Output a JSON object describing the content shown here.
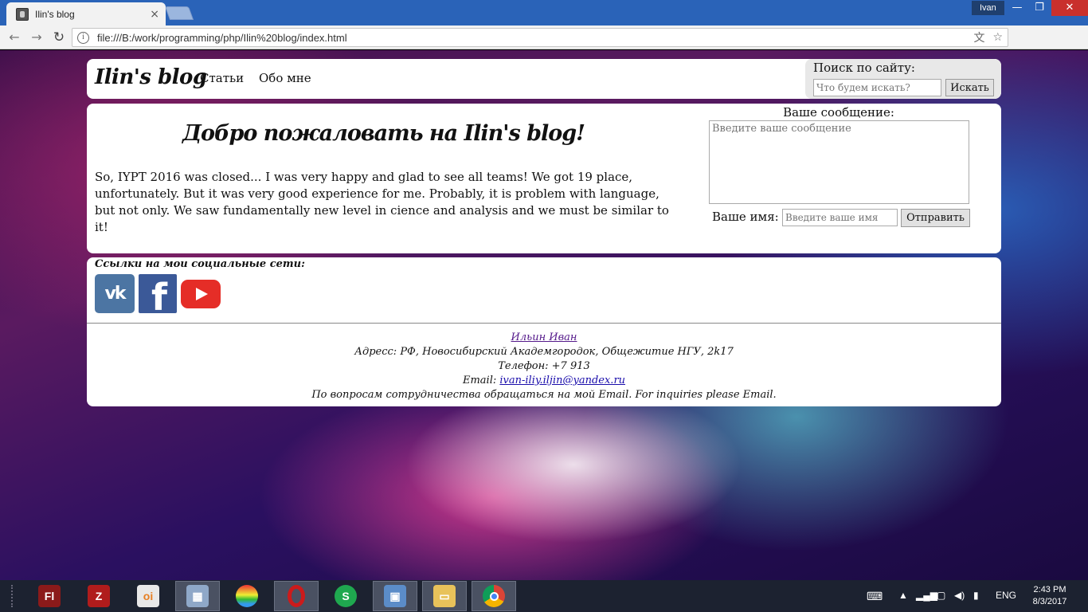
{
  "browser": {
    "tab_title": "Ilin's blog",
    "tab_close": "×",
    "profile_name": "Ivan",
    "url": "file:///B:/work/programming/php/Ilin%20blog/index.html",
    "minimize": "—",
    "maximize": "❐",
    "close": "✕",
    "back": "←",
    "forward": "→",
    "reload": "↻",
    "info": "i",
    "translate_icon": "文",
    "star_icon": "☆"
  },
  "header": {
    "logo": "Ilin's blog",
    "nav": [
      {
        "label": "Статьи"
      },
      {
        "label": "Обо мне"
      }
    ],
    "search": {
      "title": "Поиск по сайту:",
      "placeholder": "Что будем искать?",
      "button": "Искать"
    }
  },
  "main": {
    "welcome": "Добро пожаловать на Ilin's blog!",
    "post": "So, IYPT 2016 was closed... I was very happy and glad to see all teams! We got 19 place, unfortunately. But it was very good experience for me. Probably, it is problem with language, but not only. We saw fundamentally new level in cience and analysis and we must be similar to it!",
    "form": {
      "message_label": "Ваше сообщение:",
      "message_placeholder": "Введите ваше сообщение",
      "name_label": "Ваше имя:",
      "name_placeholder": "Введите ваше имя",
      "send_button": "Отправить"
    }
  },
  "footer": {
    "social_title": "Ссылки на мои социальные сети:",
    "social": {
      "vk": "vk",
      "fb": "f"
    },
    "author": "Ильин Иван",
    "address": "Адресс: РФ, Новосибирский Академгородок, Общежитие НГУ, 2k17",
    "phone": "Телефон: +7 913",
    "email_prefix": "Email: ",
    "email": "ivan-iliy.iljin@yandex.ru",
    "note": "По вопросам сотрудничества обращаться на мой Email. For inquiries please Email."
  },
  "taskbar": {
    "apps": [
      {
        "name": "flash",
        "glyph": "Fl",
        "color": "#8b1a1a"
      },
      {
        "name": "filezilla",
        "glyph": "Z",
        "color": "#b01c1c"
      },
      {
        "name": "origin",
        "glyph": "oi",
        "color": "#e8e8e8"
      },
      {
        "name": "monitor",
        "glyph": "▦",
        "color": "#8fa8c8"
      },
      {
        "name": "rainbow-app",
        "glyph": "",
        "color": "#e0a020"
      },
      {
        "name": "opera",
        "glyph": "O",
        "color": "#cc1b1b"
      },
      {
        "name": "s-app",
        "glyph": "S",
        "color": "#1fa84f"
      },
      {
        "name": "virtualbox",
        "glyph": "▣",
        "color": "#5b8cc8"
      },
      {
        "name": "file-explorer",
        "glyph": "▭",
        "color": "#e8c25a"
      },
      {
        "name": "chrome",
        "glyph": "◉",
        "color": "#e8e8e8"
      }
    ],
    "language": "ENG",
    "time": "2:43 PM",
    "date": "8/3/2017"
  }
}
